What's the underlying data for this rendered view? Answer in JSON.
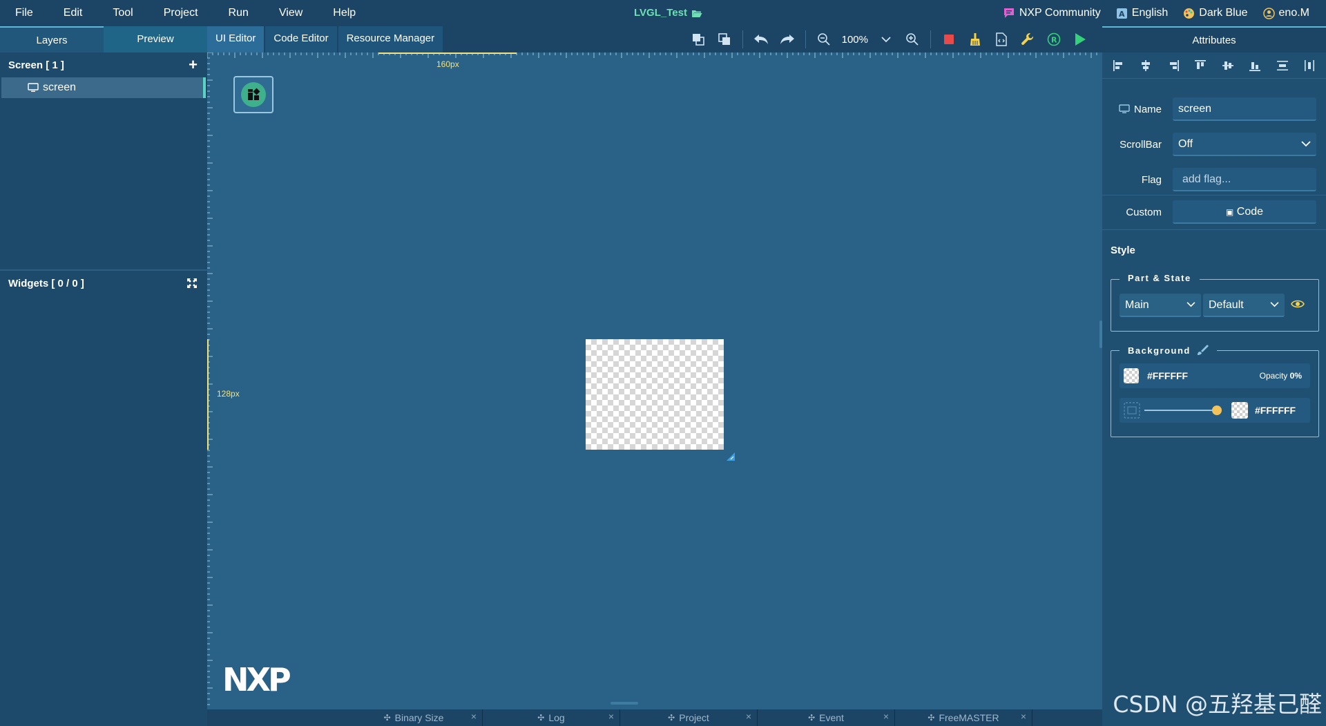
{
  "menubar": {
    "items": [
      "File",
      "Edit",
      "Tool",
      "Project",
      "Run",
      "View",
      "Help"
    ],
    "app_title": "LVGL_Test",
    "right": {
      "community": "NXP Community",
      "language": "English",
      "theme": "Dark Blue",
      "user": "eno.M"
    }
  },
  "left_panel": {
    "tabs": [
      "Layers",
      "Preview"
    ],
    "screen_header": "Screen [ 1 ]",
    "screen_items": [
      "screen"
    ],
    "widgets_header": "Widgets [ 0 / 0 ]"
  },
  "editor_tabs": [
    "UI Editor",
    "Code Editor",
    "Resource Manager"
  ],
  "toolbar": {
    "zoom": "100%"
  },
  "canvas": {
    "ruler_top_label": "160px",
    "ruler_left_label": "128px",
    "logo_text": "NXP"
  },
  "bottom_tabs": [
    "Binary Size",
    "Log",
    "Project",
    "Event",
    "FreeMASTER"
  ],
  "attributes": {
    "title": "Attributes",
    "name_label": "Name",
    "name_value": "screen",
    "scrollbar_label": "ScrollBar",
    "scrollbar_value": "Off",
    "flag_label": "Flag",
    "flag_placeholder": "add flag...",
    "custom_label": "Custom",
    "code_button": "Code",
    "style_title": "Style",
    "part_state_legend": "Part & State",
    "part_value": "Main",
    "state_value": "Default",
    "background_legend": "Background",
    "bg_color": "#FFFFFF",
    "opacity_label": "Opacity",
    "opacity_value": "0%",
    "gradient_color": "#FFFFFF",
    "gradient_level": 1.0
  },
  "watermark": "CSDN @五羟基己醛",
  "colors": {
    "accent_green": "#6ee0b4",
    "stop_red": "#e84a4a",
    "run_green": "#34d17a",
    "yellow": "#f5d04a"
  }
}
